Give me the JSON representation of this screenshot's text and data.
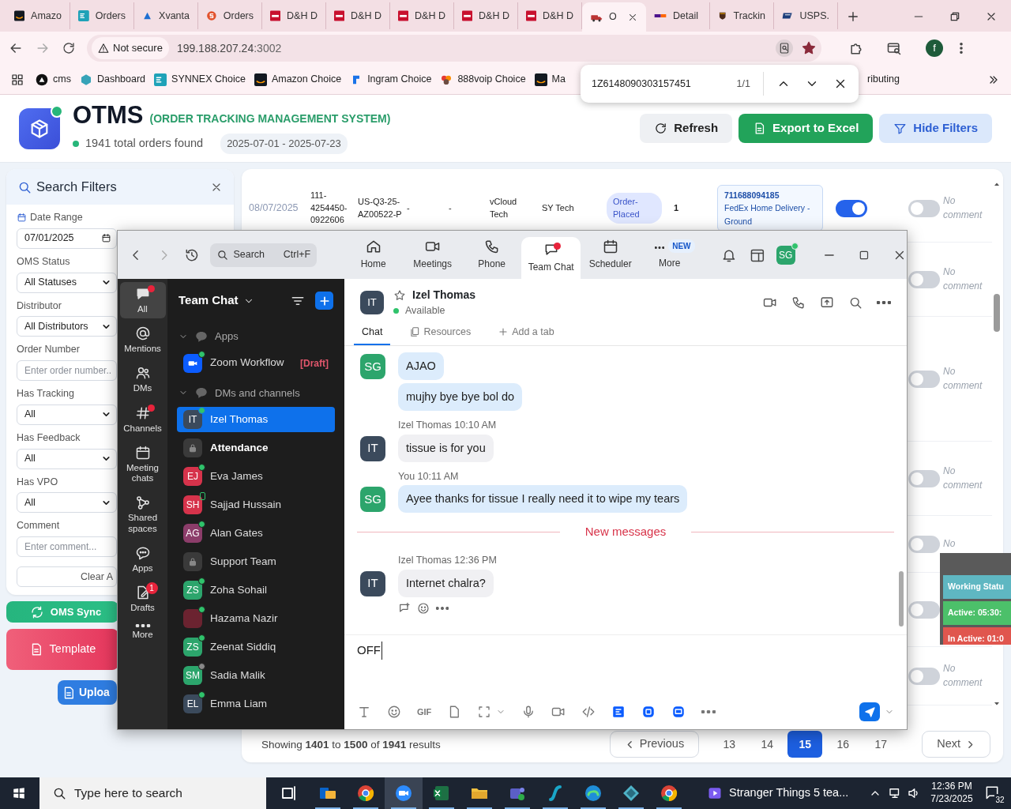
{
  "browser": {
    "tabs": [
      {
        "title": "Amazo",
        "kind": "amazon",
        "selected": false
      },
      {
        "title": "Orders",
        "kind": "ec",
        "selected": false
      },
      {
        "title": "Xvanta",
        "kind": "xvanta",
        "selected": false
      },
      {
        "title": "Orders",
        "kind": "s",
        "selected": false
      },
      {
        "title": "D&H D",
        "kind": "dh",
        "selected": false
      },
      {
        "title": "D&H D",
        "kind": "dh",
        "selected": false
      },
      {
        "title": "D&H D",
        "kind": "dh",
        "selected": false
      },
      {
        "title": "D&H D",
        "kind": "dh",
        "selected": false
      },
      {
        "title": "D&H D",
        "kind": "dh",
        "selected": false
      },
      {
        "title": "O",
        "kind": "truck",
        "selected": true
      },
      {
        "title": "Detail",
        "kind": "fedex",
        "selected": false
      },
      {
        "title": "Trackin",
        "kind": "ups",
        "selected": false
      },
      {
        "title": "USPS.",
        "kind": "usps",
        "selected": false
      }
    ],
    "address": {
      "security": "Not secure",
      "host": "199.188.207.24",
      "port": ":3002",
      "bookmarked": true,
      "profile": "f"
    },
    "bookmarks": [
      {
        "label": "cms",
        "kind": "cms"
      },
      {
        "label": "Dashboard",
        "kind": "hex"
      },
      {
        "label": "SYNNEX Choice",
        "kind": "ec"
      },
      {
        "label": "Amazon Choice",
        "kind": "amazon"
      },
      {
        "label": "Ingram Choice",
        "kind": "ingram"
      },
      {
        "label": "888voip Choice",
        "kind": "voip"
      },
      {
        "label": "Ma",
        "kind": "amazon"
      },
      {
        "label": "ributing",
        "kind": "none"
      }
    ],
    "find_bar": {
      "query": "1Z6148090303157451",
      "count": "1/1"
    }
  },
  "page": {
    "title": "OTMS",
    "subtitle": "(ORDER TRACKING MANAGEMENT SYSTEM)",
    "summary": "1941 total orders found",
    "date_range": "2025-07-01 - 2025-07-23",
    "buttons": [
      {
        "label": "Refresh",
        "kind": "refresh"
      },
      {
        "label": "Export to Excel",
        "kind": "excel"
      },
      {
        "label": "Hide Filters",
        "kind": "filter"
      }
    ],
    "filters": {
      "title": "Search Filters",
      "fields": [
        {
          "label": "Date Range",
          "kind": "date",
          "value": "07/01/2025"
        },
        {
          "label": "OMS Status",
          "kind": "select",
          "value": "All Statuses"
        },
        {
          "label": "Distributor",
          "kind": "select",
          "value": "All Distributors"
        },
        {
          "label": "Order Number",
          "kind": "text",
          "placeholder": "Enter order number.."
        },
        {
          "label": "Has Tracking",
          "kind": "select",
          "value": "All"
        },
        {
          "label": "Has Feedback",
          "kind": "select",
          "value": "All"
        },
        {
          "label": "Has VPO",
          "kind": "select",
          "value": "All"
        },
        {
          "label": "Comment",
          "kind": "text",
          "placeholder": "Enter comment..."
        }
      ],
      "clear": "Clear A"
    },
    "actions": [
      {
        "label": "OMS Sync",
        "kind": "sync"
      },
      {
        "label": "Template",
        "kind": "template"
      },
      {
        "label": "Uploa",
        "kind": "upload"
      }
    ],
    "rows": [
      {
        "cells": [
          {
            "kind": "date",
            "text": "08/07/2025"
          },
          {
            "kind": "text",
            "text": "111-4254450-0922606"
          },
          {
            "kind": "text",
            "text": "US-Q3-25-AZ00522-P"
          },
          {
            "kind": "text",
            "text": "-"
          },
          {
            "kind": "text",
            "text": "-"
          },
          {
            "kind": "text",
            "text": "vCloud Tech"
          },
          {
            "kind": "text",
            "text": "SY Tech"
          },
          {
            "kind": "badge",
            "text": "Order-Placed"
          },
          {
            "kind": "bold",
            "text": "1"
          },
          {
            "kind": "tracking",
            "number": "711688094185",
            "service": "FedEx Home Delivery - Ground"
          },
          {
            "kind": "switch",
            "on": true
          },
          {
            "kind": "switch",
            "on": false
          },
          {
            "kind": "comment",
            "text": "No comment"
          }
        ]
      },
      {
        "cells": [
          {
            "kind": "switch",
            "on": false
          },
          {
            "kind": "comment",
            "text": "No comment"
          }
        ]
      },
      {
        "cells": [
          {
            "kind": "switch",
            "on": false
          },
          {
            "kind": "comment",
            "text": "No comment"
          }
        ]
      },
      {
        "cells": [
          {
            "kind": "switch",
            "on": false
          },
          {
            "kind": "comment",
            "text": "No comment"
          }
        ]
      },
      {
        "cells": [
          {
            "kind": "switch",
            "on": false
          },
          {
            "kind": "comment",
            "text": "No"
          }
        ]
      },
      {
        "cells": [
          {
            "kind": "switch",
            "on": false
          }
        ]
      },
      {
        "cells": [
          {
            "kind": "switch",
            "on": false
          },
          {
            "kind": "comment",
            "text": "No comment"
          }
        ]
      }
    ],
    "pagination": {
      "summary": "Showing **1401** to **1500** of **1941** results",
      "previous": "Previous",
      "next": "Next",
      "pages": [
        {
          "label": "13",
          "selected": false
        },
        {
          "label": "14",
          "selected": false
        },
        {
          "label": "15",
          "selected": true
        },
        {
          "label": "16",
          "selected": false
        },
        {
          "label": "17",
          "selected": false
        }
      ]
    },
    "work_status": {
      "title": "Working Statu",
      "active": "Active: 05:30:",
      "inactive": "In Active: 01:0"
    }
  },
  "zoom": {
    "search": {
      "placeholder": "Search",
      "shortcut": "Ctrl+F"
    },
    "nav": [
      {
        "label": "Home",
        "kind": "home",
        "selected": false,
        "unread": false
      },
      {
        "label": "Meetings",
        "kind": "video",
        "selected": false,
        "unread": false
      },
      {
        "label": "Phone",
        "kind": "phone",
        "selected": false,
        "unread": false
      },
      {
        "label": "Team Chat",
        "kind": "chat",
        "selected": true,
        "unread": true
      },
      {
        "label": "Scheduler",
        "kind": "calendar",
        "selected": false,
        "unread": false
      },
      {
        "label": "More",
        "kind": "dots",
        "selected": false,
        "unread": false,
        "badge": "NEW"
      }
    ],
    "user_initials": "SG",
    "rail": [
      {
        "label": "All",
        "kind": "chat",
        "selected": true,
        "unread": true
      },
      {
        "label": "Mentions",
        "kind": "at",
        "selected": false,
        "unread": false
      },
      {
        "label": "DMs",
        "kind": "people",
        "selected": false,
        "unread": false
      },
      {
        "label": "Channels",
        "kind": "hash",
        "selected": false,
        "unread": true
      },
      {
        "label": "Meeting chats",
        "kind": "calendar",
        "selected": false,
        "unread": false
      },
      {
        "label": "Shared spaces",
        "kind": "share",
        "selected": false,
        "unread": false
      },
      {
        "label": "Apps",
        "kind": "bubble",
        "selected": false,
        "unread": false
      },
      {
        "label": "Drafts",
        "kind": "draft",
        "selected": false,
        "unread": false,
        "badge": "1"
      },
      {
        "label": "More",
        "kind": "dots",
        "selected": false,
        "unread": false
      }
    ],
    "sidebar": {
      "title": "Team Chat",
      "sections": [
        {
          "label": "Apps",
          "expanded": true,
          "items": [
            {
              "name": "Zoom Workflow",
              "kind": "app",
              "presence": {
                "kind": "online"
              },
              "selected": false,
              "unread": false,
              "tag": "[Draft]"
            }
          ]
        },
        {
          "label": "DMs and channels",
          "expanded": true,
          "items": [
            {
              "name": "Izel Thomas",
              "kind": "person",
              "initials": "IT",
              "color": "#3b4a5c",
              "presence": {
                "kind": "online"
              },
              "selected": true,
              "unread": false
            },
            {
              "name": "Attendance",
              "kind": "channel",
              "selected": false,
              "unread": true
            },
            {
              "name": "Eva James",
              "kind": "person",
              "initials": "EJ",
              "color": "#d6334b",
              "presence": {
                "kind": "online"
              },
              "selected": false,
              "unread": false
            },
            {
              "name": "Sajjad Hussain",
              "kind": "person",
              "initials": "SH",
              "color": "#d6334b",
              "presence": {
                "kind": "mobile"
              },
              "selected": false,
              "unread": false
            },
            {
              "name": "Alan Gates",
              "kind": "person",
              "initials": "AG",
              "color": "#8c3d6a",
              "presence": {
                "kind": "online"
              },
              "selected": false,
              "unread": false
            },
            {
              "name": "Support Team",
              "kind": "channel",
              "selected": false,
              "unread": false
            },
            {
              "name": "Zoha Sohail",
              "kind": "person",
              "initials": "ZS",
              "color": "#2ca56c",
              "presence": {
                "kind": "online"
              },
              "selected": false,
              "unread": false
            },
            {
              "name": "Hazama Nazir",
              "kind": "photo",
              "color": "#6b2330",
              "presence": {
                "kind": "online"
              },
              "selected": false,
              "unread": false
            },
            {
              "name": "Zeenat Siddiq",
              "kind": "person",
              "initials": "ZS",
              "color": "#2ca56c",
              "presence": {
                "kind": "online"
              },
              "selected": false,
              "unread": false
            },
            {
              "name": "Sadia Malik",
              "kind": "person",
              "initials": "SM",
              "color": "#2ca56c",
              "presence": {
                "kind": "away"
              },
              "selected": false,
              "unread": false
            },
            {
              "name": "Emma Liam",
              "kind": "person",
              "initials": "EL",
              "color": "#3b4a5c",
              "presence": {
                "kind": "online"
              },
              "selected": false,
              "unread": false
            }
          ]
        }
      ]
    },
    "chat": {
      "name": "Izel Thomas",
      "initials": "IT",
      "status": "Available",
      "starred": false,
      "tabs": [
        {
          "label": "Chat",
          "kind": "none",
          "selected": true
        },
        {
          "label": "Resources",
          "kind": "files",
          "selected": false
        },
        {
          "label": "Add a tab",
          "kind": "add",
          "selected": false
        }
      ],
      "messages": [
        {
          "kind": "mine",
          "initials": "SG",
          "bubbles": [
            "AJAO",
            "mujhy bye bye bol do"
          ]
        },
        {
          "kind": "theirs",
          "author": "Izel Thomas",
          "time": "10:10 AM",
          "initials": "IT",
          "bubbles": [
            "tissue is for you"
          ]
        },
        {
          "kind": "mine",
          "author": "You",
          "time": "10:11 AM",
          "initials": "SG",
          "bubbles": [
            "Ayee thanks for tissue I really need it to wipe my tears"
          ]
        },
        {
          "kind": "divider",
          "label": "New messages"
        },
        {
          "kind": "theirs",
          "author": "Izel Thomas",
          "time": "12:36 PM",
          "initials": "IT",
          "bubbles": [
            "Internet chalra?"
          ],
          "reactions": true
        }
      ],
      "composer": {
        "value": "OFF"
      },
      "toolbar": [
        {
          "kind": "format"
        },
        {
          "kind": "emoji"
        },
        {
          "kind": "gif",
          "label": "GIF"
        },
        {
          "kind": "file"
        },
        {
          "kind": "screenshot"
        },
        {
          "kind": "caret"
        },
        {
          "kind": "mic"
        },
        {
          "kind": "video"
        },
        {
          "kind": "code"
        },
        {
          "kind": "app1"
        },
        {
          "kind": "app2"
        },
        {
          "kind": "app3"
        },
        {
          "kind": "more"
        }
      ]
    }
  },
  "taskbar": {
    "search_placeholder": "Type here to search",
    "apps": [
      {
        "kind": "taskview",
        "active": false
      },
      {
        "kind": "outlook",
        "active": false
      },
      {
        "kind": "chrome",
        "active": false
      },
      {
        "kind": "zoom",
        "active": true
      },
      {
        "kind": "excel",
        "active": false
      },
      {
        "kind": "folder",
        "active": false
      },
      {
        "kind": "teams",
        "active": false
      },
      {
        "kind": "sigma",
        "active": false
      },
      {
        "kind": "edge",
        "active": false
      },
      {
        "kind": "diamond",
        "active": false
      },
      {
        "kind": "chrome",
        "active": false
      }
    ],
    "media": "Stranger Things 5 tea...",
    "time": "12:36 PM",
    "date": "7/23/2025",
    "notifications": "32"
  }
}
